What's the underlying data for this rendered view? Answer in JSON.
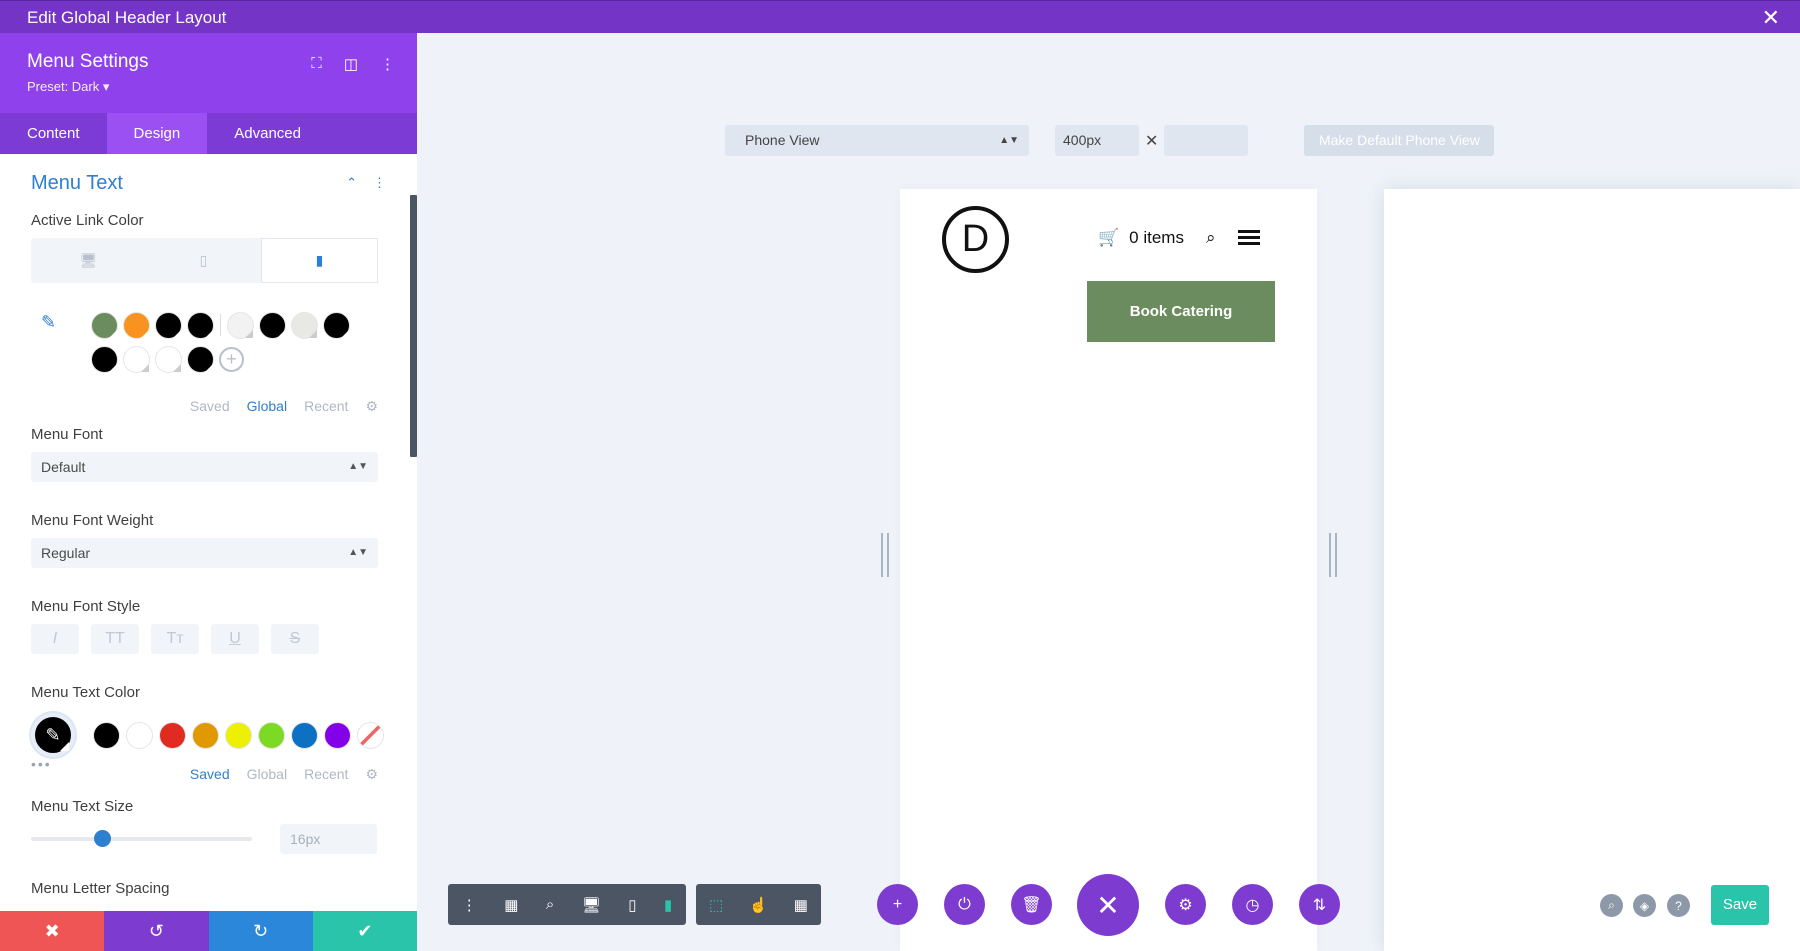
{
  "window": {
    "title": "Edit Global Header Layout",
    "close": "✕"
  },
  "panel": {
    "title": "Menu Settings",
    "preset": "Preset: Dark ▾",
    "tabs": [
      "Content",
      "Design",
      "Advanced"
    ],
    "section_title": "Menu Text",
    "active_link_color_label": "Active Link Color",
    "palette_tabs": [
      "Saved",
      "Global",
      "Recent"
    ],
    "menu_font_label": "Menu Font",
    "menu_font_value": "Default",
    "menu_font_weight_label": "Menu Font Weight",
    "menu_font_weight_value": "Regular",
    "menu_font_style_label": "Menu Font Style",
    "font_style_buttons": [
      "I",
      "TT",
      "Tт",
      "U",
      "S"
    ],
    "menu_text_color_label": "Menu Text Color",
    "palette_tabs_2": [
      "Saved",
      "Global",
      "Recent"
    ],
    "menu_text_size_label": "Menu Text Size",
    "menu_text_size_value": "16px",
    "menu_text_size_fraction": 0.32,
    "menu_letter_spacing_label": "Menu Letter Spacing"
  },
  "colors": {
    "active_link_swatches": [
      "#6b8c5e",
      "#f7931e",
      "#000000",
      "#000000",
      "#f2f2f2",
      "#000000",
      "#e8e8e4",
      "#000000",
      "#000000",
      "#ffffff",
      "#ffffff",
      "#000000"
    ],
    "text_color_swatches": [
      "#000000",
      "#ffffff",
      "#e02b20",
      "#e09900",
      "#edf000",
      "#7cda24",
      "#0c71c3",
      "#8300e9"
    ],
    "accent": "#7434c5",
    "blue": "#2e7fd0"
  },
  "canvas": {
    "view_select": "Phone View",
    "width_value": "400px",
    "times": "✕",
    "make_default": "Make Default Phone View",
    "logo_letter": "D",
    "cart_text": "0 items",
    "book_button": "Book Catering"
  },
  "footer": {
    "save": "Save"
  }
}
